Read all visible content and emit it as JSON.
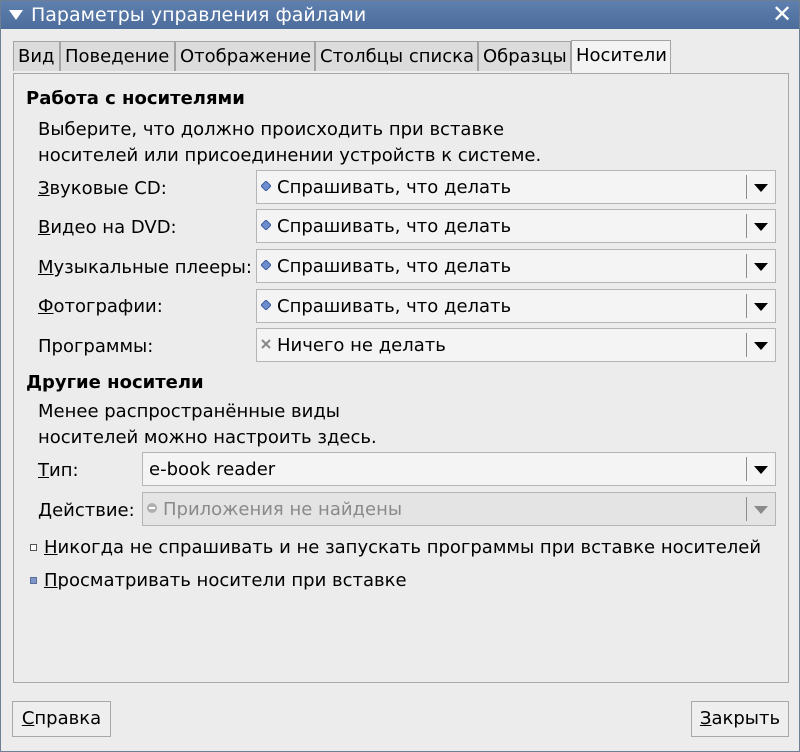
{
  "window": {
    "title": "Параметры управления файлами"
  },
  "tabs": [
    {
      "label": "Вид"
    },
    {
      "label": "Поведение"
    },
    {
      "label": "Отображение"
    },
    {
      "label": "Столбцы списка"
    },
    {
      "label": "Образцы"
    },
    {
      "label": "Носители",
      "active": true
    }
  ],
  "media_handling": {
    "title": "Работа с носителями",
    "desc_line1": "Выберите, что должно происходить при вставке",
    "desc_line2": "носителей или присоединении устройств к системе.",
    "rows": [
      {
        "label": "Звуковые CD:",
        "accel": "З",
        "rest": "вуковые CD:",
        "value": "Спрашивать, что делать",
        "icon": "ask-diamond-icon"
      },
      {
        "label": "Видео на DVD:",
        "accel": "В",
        "rest": "идео на DVD:",
        "value": "Спрашивать, что делать",
        "icon": "ask-diamond-icon"
      },
      {
        "label": "Музыкальные плееры:",
        "accel": "М",
        "rest": "узыкальные плееры:",
        "value": "Спрашивать, что делать",
        "icon": "ask-diamond-icon"
      },
      {
        "label": "Фотографии:",
        "accel": "Ф",
        "rest": "отографии:",
        "value": "Спрашивать, что делать",
        "icon": "ask-diamond-icon"
      },
      {
        "label": "Программы:",
        "accel": "",
        "rest": "Программы:",
        "value": "Ничего не делать",
        "icon": "x-icon"
      }
    ]
  },
  "other_media": {
    "title": "Другие носители",
    "desc_line1": "Менее распространённые виды",
    "desc_line2": "носителей можно настроить здесь.",
    "type_label_accel": "Т",
    "type_label_rest": "ип:",
    "type_value": "e-book reader",
    "action_label": "Действие:",
    "action_value": "Приложения не найдены"
  },
  "checks": [
    {
      "accel": "Н",
      "rest": "икогда не спрашивать и не запускать программы при вставке носителей",
      "checked": false
    },
    {
      "accel": "П",
      "rest": "росматривать носители при вставке",
      "checked": true
    }
  ],
  "buttons": {
    "help_accel": "С",
    "help_rest": "правка",
    "close_accel": "З",
    "close_rest": "акрыть"
  },
  "colors": {
    "titlebar": "#4c6d9c",
    "ask_icon": "#6d8fd0"
  }
}
